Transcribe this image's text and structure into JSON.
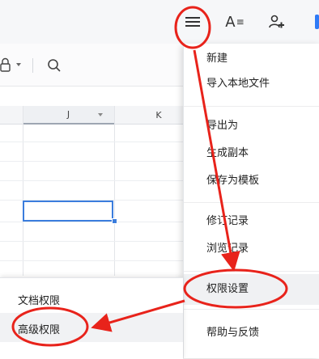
{
  "sheet": {
    "columns": [
      "J",
      "K"
    ]
  },
  "menu": {
    "items": [
      {
        "label": "新建"
      },
      {
        "label": "导入本地文件"
      },
      {
        "label": "导出为"
      },
      {
        "label": "生成副本"
      },
      {
        "label": "保存为模板"
      },
      {
        "label": "修订记录"
      },
      {
        "label": "浏览记录"
      },
      {
        "label": "权限设置"
      },
      {
        "label": "帮助与反馈"
      }
    ]
  },
  "submenu": {
    "items": [
      {
        "label": "文档权限"
      },
      {
        "label": "高级权限"
      }
    ]
  },
  "icons": {
    "menu": "hamburger-menu-icon",
    "font": "font-style-icon",
    "user": "user-share-icon",
    "lock": "lock-icon",
    "search": "search-icon"
  },
  "colors": {
    "annotation": "#e8231b",
    "accent": "#2f7bf6",
    "selection": "#3b7ddd"
  }
}
